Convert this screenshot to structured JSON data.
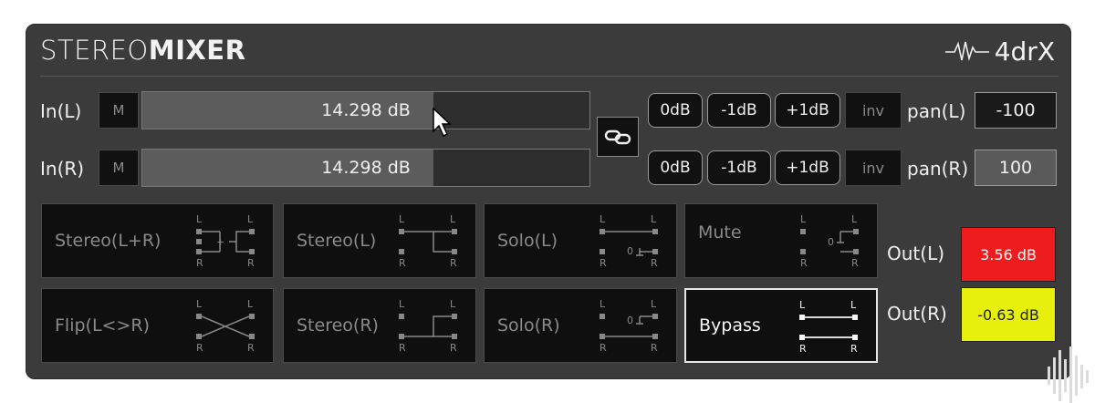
{
  "header": {
    "title_light": "STEREO",
    "title_bold": "MIXER",
    "brand": "4drX"
  },
  "inputs": [
    {
      "label": "In(L)",
      "mute_label": "M",
      "gain_text": "14.298 dB",
      "gain_fill_fraction": 0.65,
      "buttons": [
        "0dB",
        "-1dB",
        "+1dB"
      ],
      "inv_label": "inv",
      "pan_label": "pan(L)",
      "pan_value": "-100"
    },
    {
      "label": "In(R)",
      "mute_label": "M",
      "gain_text": "14.298 dB",
      "gain_fill_fraction": 0.65,
      "buttons": [
        "0dB",
        "-1dB",
        "+1dB"
      ],
      "inv_label": "inv",
      "pan_label": "pan(R)",
      "pan_value": "100"
    }
  ],
  "link_icon": "chain-link-icon",
  "modes": [
    {
      "label": "Stereo(L+R)",
      "icon": "stereo-sum-routing-icon",
      "active": false
    },
    {
      "label": "Stereo(L)",
      "icon": "stereo-left-routing-icon",
      "active": false
    },
    {
      "label": "Solo(L)",
      "icon": "solo-left-routing-icon",
      "active": false
    },
    {
      "label": "Mute",
      "icon": "mute-routing-icon",
      "active": false
    },
    {
      "label": "Flip(L<>R)",
      "icon": "flip-routing-icon",
      "active": false
    },
    {
      "label": "Stereo(R)",
      "icon": "stereo-right-routing-icon",
      "active": false
    },
    {
      "label": "Solo(R)",
      "icon": "solo-right-routing-icon",
      "active": false
    },
    {
      "label": "Bypass",
      "icon": "bypass-routing-icon",
      "active": true
    }
  ],
  "routing_labels": {
    "left": "L",
    "right": "R",
    "zero": "0",
    "plus": "+"
  },
  "outputs": [
    {
      "label": "Out(L)",
      "value": "3.56 dB",
      "color": "#ee1c1c"
    },
    {
      "label": "Out(R)",
      "value": "-0.63 dB",
      "color": "#e6f00c"
    }
  ],
  "colors": {
    "panel": "#3b3b3b",
    "button": "#111111",
    "active_border": "#e6e6e6"
  }
}
